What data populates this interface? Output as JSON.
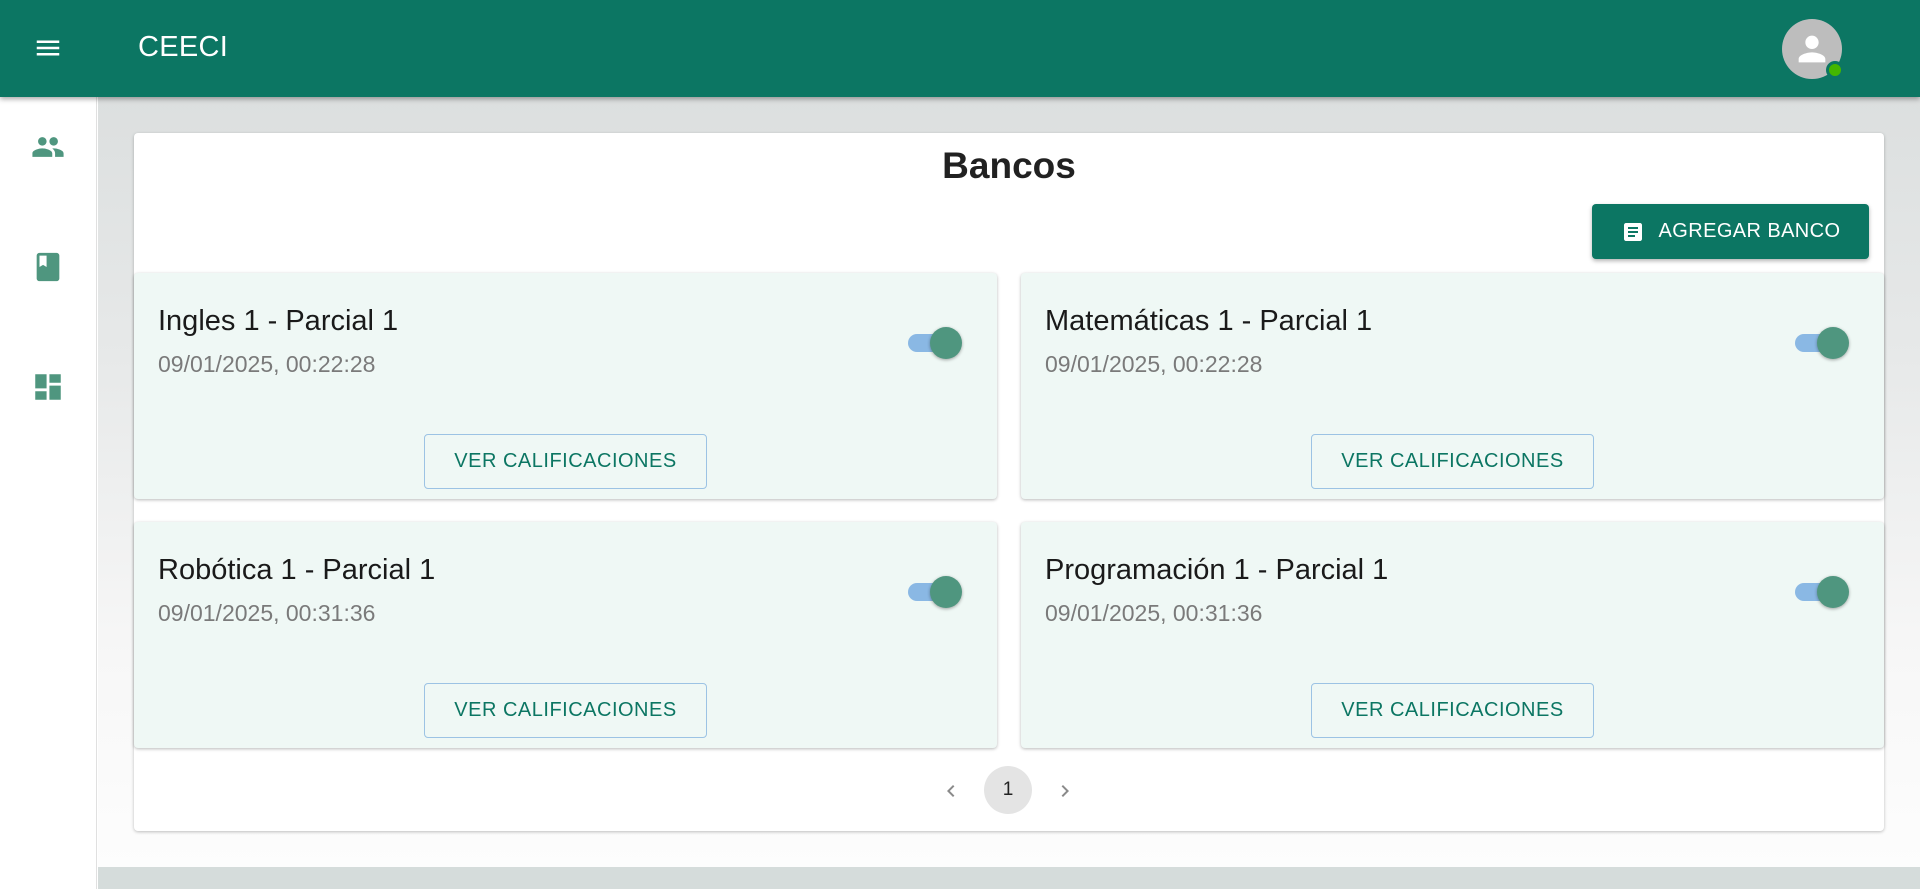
{
  "app": {
    "title": "CEECI"
  },
  "icons": {
    "menu": "menu-icon",
    "avatar": "person-icon",
    "sidebar": [
      "people-icon",
      "book-icon",
      "dashboard-icon"
    ],
    "add": "document-icon"
  },
  "colors": {
    "primary": "#0c7663",
    "card_bg": "#eff8f5",
    "switch_track": "#8ab8e4",
    "switch_thumb": "#4f967f",
    "online": "#44b700"
  },
  "page": {
    "title": "Bancos",
    "add_button": "AGREGAR BANCO"
  },
  "banks": [
    {
      "name": "Ingles 1 - Parcial 1",
      "date": "09/01/2025, 00:22:28",
      "enabled": true,
      "button": "VER CALIFICACIONES"
    },
    {
      "name": "Matemáticas 1 - Parcial 1",
      "date": "09/01/2025, 00:22:28",
      "enabled": true,
      "button": "VER CALIFICACIONES"
    },
    {
      "name": "Robótica 1 - Parcial 1",
      "date": "09/01/2025, 00:31:36",
      "enabled": true,
      "button": "VER CALIFICACIONES"
    },
    {
      "name": "Programación 1 - Parcial 1",
      "date": "09/01/2025, 00:31:36",
      "enabled": true,
      "button": "VER CALIFICACIONES"
    }
  ],
  "pagination": {
    "current": "1"
  }
}
